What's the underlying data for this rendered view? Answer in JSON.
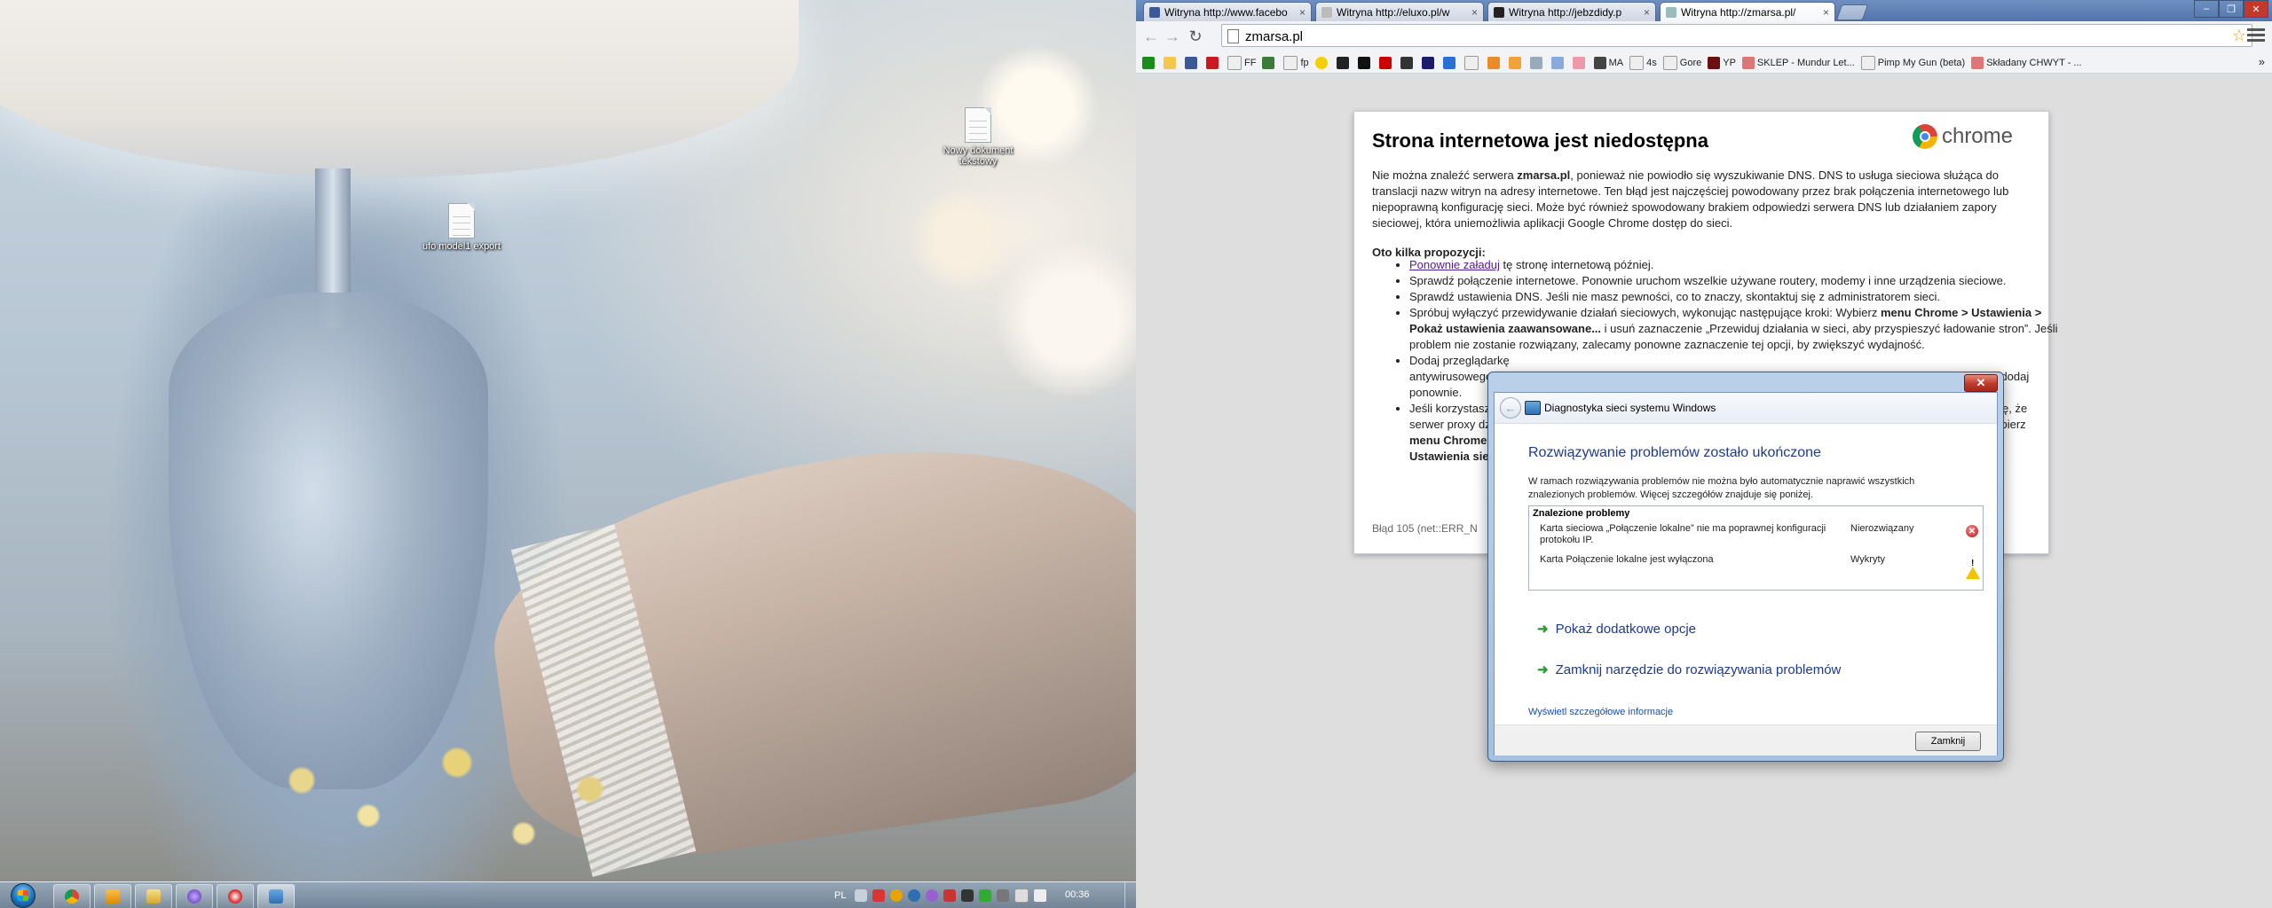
{
  "desktop": {
    "icons": [
      {
        "label": "Nowy dokument tekstowy"
      },
      {
        "label": "ufo model1 export"
      }
    ],
    "taskbar": {
      "language": "PL",
      "clock": "00:36"
    }
  },
  "chrome": {
    "tabs": [
      {
        "title": "Witryna http://www.facebo"
      },
      {
        "title": "Witryna http://eluxo.pl/w"
      },
      {
        "title": "Witryna http://jebzdidy.p"
      },
      {
        "title": "Witryna http://zmarsa.pl/"
      }
    ],
    "address": "zmarsa.pl",
    "bookmarks": [
      "",
      "",
      "",
      "FF",
      "",
      "fp",
      "",
      "",
      "",
      "",
      "",
      "",
      "",
      "",
      "",
      "",
      "",
      "",
      "",
      "MA",
      "4s",
      "Gore",
      "YP",
      "SKLEP - Mundur Let...",
      "Pimp My Gun (beta)",
      "Składany CHWYT - ..."
    ],
    "bookmarks_more": "»",
    "error_page": {
      "heading": "Strona internetowa jest niedostępna",
      "logo_text": "chrome",
      "para_before": "Nie można znaleźć serwera ",
      "para_server": "zmarsa.pl",
      "para_after": ", ponieważ nie powiodło się wyszukiwanie DNS. DNS to usługa sieciowa służąca do translacji nazw witryn na adresy internetowe. Ten błąd jest najczęściej powodowany przez brak połączenia internetowego lub niepoprawną konfigurację sieci. Może być również spowodowany brakiem odpowiedzi serwera DNS lub działaniem zapory sieciowej, która uniemożliwia aplikacji Google Chrome dostęp do sieci.",
      "suggestions_title": "Oto kilka propozycji:",
      "s1_link": "Ponownie załaduj",
      "s1_rest": " tę stronę internetową później.",
      "s2": "Sprawdź połączenie internetowe. Ponownie uruchom wszelkie używane routery, modemy i inne urządzenia sieciowe.",
      "s3": "Sprawdź ustawienia DNS. Jeśli nie masz pewności, co to znaczy, skontaktuj się z administratorem sieci.",
      "s4_a": "Spróbuj wyłączyć przewidywanie działań sieciowych, wykonując następujące kroki: Wybierz ",
      "s4_b": "menu Chrome > Ustawienia > Pokaż ustawienia zaawansowane...",
      "s4_c": " i usuń zaznaczenie „Przewiduj działania w sieci, aby przyspieszyć ładowanie stron”. Jeśli problem nie zostanie rozwiązany, zalecamy ponowne zaznaczenie tej opcji, by zwiększyć wydajność.",
      "s5": "Dodaj przeglądarkę",
      "s5_b": "antywirusowego",
      "s5_right": "ę, dodaj",
      "s5_c": "ponownie.",
      "s6": "Jeśli korzystasz",
      "s6_right": "ę, że",
      "s6_b": "serwer proxy dz",
      "s6_right2": "ybierz",
      "s6_c": "menu Chrome",
      "s6_d": "Ustawienia sie",
      "error_code": "Błąd 105 (net::ERR_N"
    }
  },
  "dialog": {
    "window_title": "Diagnostyka sieci systemu Windows",
    "heading": "Rozwiązywanie problemów zostało ukończone",
    "description": "W ramach rozwiązywania problemów nie można było automatycznie naprawić wszystkich znalezionych problemów. Więcej szczegółów znajduje się poniżej.",
    "problems_header": "Znalezione problemy",
    "problems": [
      {
        "text": "Karta sieciowa „Połączenie lokalne” nie ma poprawnej konfiguracji protokołu IP.",
        "status": "Nierozwiązany",
        "icon": "error-icon"
      },
      {
        "text": "Karta Połączenie lokalne jest wyłączona",
        "status": "Wykryty",
        "icon": "warning-icon"
      }
    ],
    "option1": "Pokaż dodatkowe opcje",
    "option2": "Zamknij narzędzie do rozwiązywania problemów",
    "details_link": "Wyświetl szczegółowe informacje",
    "close_button": "Zamknij"
  }
}
